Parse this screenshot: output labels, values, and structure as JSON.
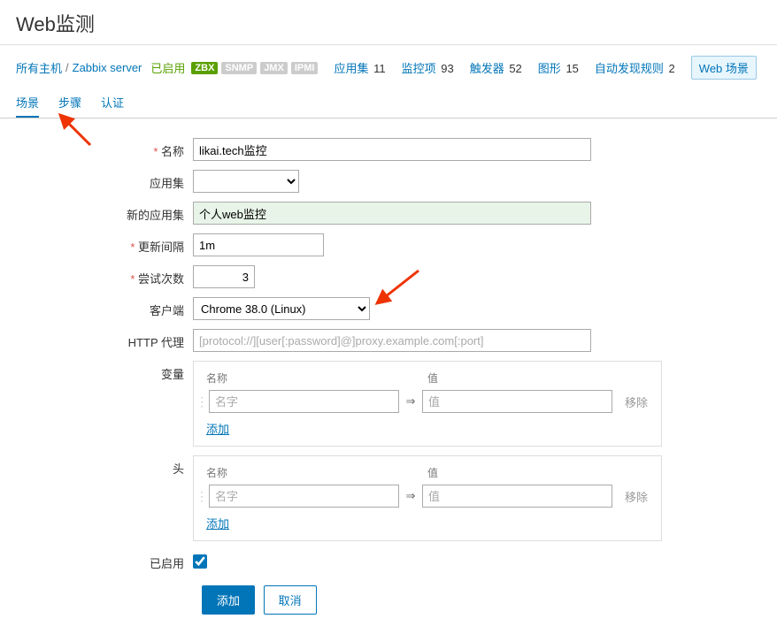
{
  "page": {
    "title": "Web监测"
  },
  "breadcrumb": {
    "all_hosts": "所有主机",
    "host": "Zabbix server",
    "enabled": "已启用",
    "badges": {
      "zbx": "ZBX",
      "snmp": "SNMP",
      "jmx": "JMX",
      "ipmi": "IPMI"
    },
    "nav": {
      "appsets": {
        "label": "应用集",
        "count": "11"
      },
      "items": {
        "label": "监控项",
        "count": "93"
      },
      "triggers": {
        "label": "触发器",
        "count": "52"
      },
      "graphs": {
        "label": "图形",
        "count": "15"
      },
      "discovery": {
        "label": "自动发现规则",
        "count": "2"
      },
      "web": {
        "label": "Web 场景"
      }
    }
  },
  "tabs": {
    "scene": "场景",
    "steps": "步骤",
    "auth": "认证"
  },
  "form": {
    "labels": {
      "name": "名称",
      "appset": "应用集",
      "new_appset": "新的应用集",
      "interval": "更新间隔",
      "attempts": "尝试次数",
      "agent": "客户端",
      "http_proxy": "HTTP 代理",
      "variables": "变量",
      "headers": "头",
      "enabled": "已启用"
    },
    "values": {
      "name": "likai.tech监控",
      "new_appset": "个人web监控",
      "interval": "1m",
      "attempts": "3",
      "agent": "Chrome 38.0 (Linux)",
      "enabled": true
    },
    "placeholders": {
      "http_proxy": "[protocol://][user[:password]@]proxy.example.com[:port]"
    },
    "sublabels": {
      "name_col": "名称",
      "value_col": "值",
      "name_ph": "名字",
      "value_ph": "值",
      "remove": "移除",
      "add": "添加",
      "arrow": "⇒"
    }
  },
  "buttons": {
    "submit": "添加",
    "cancel": "取消"
  }
}
